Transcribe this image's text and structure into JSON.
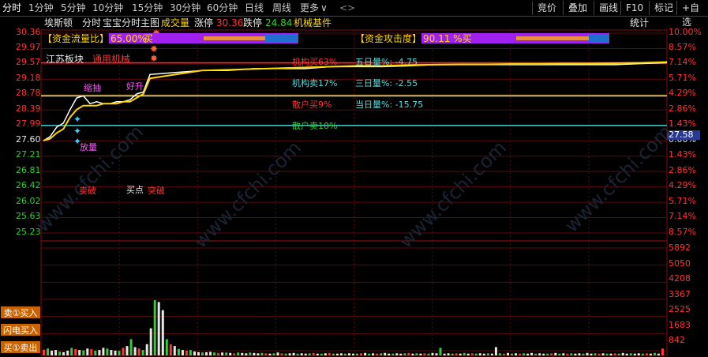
{
  "tabs": [
    {
      "label": "分时",
      "active": true
    },
    {
      "label": "1分钟"
    },
    {
      "label": "5分钟"
    },
    {
      "label": "10分钟"
    },
    {
      "label": "15分钟"
    },
    {
      "label": "30分钟"
    },
    {
      "label": "60分钟"
    },
    {
      "label": "日线"
    },
    {
      "label": "周线"
    },
    {
      "label": "更多"
    }
  ],
  "right_buttons": [
    "竞价",
    "叠加",
    "画线",
    "F10",
    "标记",
    "+自选"
  ],
  "header": {
    "stock_name": "埃斯顿",
    "mode": "分时",
    "indicator": "宝宝分时主图",
    "volume_label": "成交量",
    "limit_up_label": "涨停",
    "limit_up_value": "30.36",
    "limit_down_label": "跌停",
    "limit_down_value": "24.84",
    "sector": "机械基件",
    "stats_label": "统计"
  },
  "price_axis": [
    "30.36",
    "29.97",
    "29.57",
    "29.18",
    "28.78",
    "28.39",
    "27.99",
    "27.60",
    "27.21",
    "26.81",
    "26.42",
    "26.02",
    "25.63",
    "25.23"
  ],
  "percent_axis": [
    "10.00%",
    "8.57%",
    "7.14%",
    "5.71%",
    "4.29%",
    "2.86%",
    "1.43%",
    "0.00%",
    "1.43%",
    "2.86%",
    "4.29%",
    "5.71%",
    "7.14%",
    "8.57%"
  ],
  "current_price": "27.58",
  "volume_axis": [
    "5892",
    "5050",
    "4208",
    "3367",
    "2525",
    "1683",
    "842"
  ],
  "capital_flow": {
    "label": "【资金流量比】",
    "value": "65.00%",
    "suffix": "买"
  },
  "attack": {
    "label": "【资金攻击度】",
    "value": "90.11 %买"
  },
  "sector_labels": {
    "province": "江苏板块",
    "industry": "通用机械"
  },
  "stats": {
    "inst_buy": "机构买63%",
    "inst_sell": "机构卖17%",
    "retail_buy": "散户买9%",
    "retail_sell": "散户卖10%",
    "d5": "五日量%: -4.75",
    "d3": "三日量%: -2.55",
    "d1": "当日量%: -15.75"
  },
  "chart_annotations": {
    "sell_break": "卖破",
    "buy_point": "买点",
    "break_up": "突破",
    "fang_liang": "放量",
    "suo_chou": "缩抽",
    "hao_sheng": "好升"
  },
  "left_buttons": [
    "卖①买入",
    "闪电买入",
    "买①卖出"
  ],
  "watermark": "www.cfchi.com",
  "colors": {
    "up": "#ff3333",
    "down": "#33cc33",
    "price_line": "#ffffff",
    "avg_line": "#ffd700",
    "panel_bg": "#000000"
  },
  "chart_data": [
    {
      "type": "line",
      "title": "",
      "xlabel": "",
      "ylabel": "",
      "ylim": [
        25.23,
        30.36
      ],
      "series": [
        {
          "values": [
            27.6,
            27.7,
            27.95,
            28.05,
            28.4,
            28.7,
            28.75,
            28.55,
            28.6,
            28.55,
            28.55,
            28.6,
            28.6,
            28.65,
            28.8,
            28.85,
            29.3,
            29.35,
            29.4,
            29.4,
            29.45,
            29.45,
            29.45,
            29.5,
            29.5,
            29.5,
            29.52,
            29.55,
            29.55,
            29.55,
            29.55,
            29.55,
            29.55,
            29.55,
            29.55,
            29.58,
            29.6
          ]
        },
        {
          "values": [
            27.6,
            27.65,
            27.8,
            27.9,
            28.2,
            28.4,
            28.5,
            28.5,
            28.5,
            28.55,
            28.55,
            28.55,
            28.6,
            28.6,
            28.7,
            28.8,
            29.2,
            29.3,
            29.4,
            29.42,
            29.44,
            29.46,
            29.48,
            29.5,
            29.52,
            29.52,
            29.54,
            29.55,
            29.56,
            29.56,
            29.57,
            29.57,
            29.58,
            29.58,
            29.59,
            29.6,
            29.62
          ]
        }
      ]
    },
    {
      "type": "bar",
      "title": "",
      "ylabel": "",
      "ylim": [
        0,
        5892
      ],
      "values": [
        320,
        380,
        260,
        300,
        210,
        180,
        260,
        420,
        350,
        300,
        280,
        380,
        340,
        260,
        300,
        420,
        380,
        300,
        260,
        250,
        420,
        520,
        900,
        460,
        380,
        300,
        620,
        1500,
        3050,
        2950,
        2500,
        900,
        620,
        520,
        360,
        300,
        260,
        300,
        220,
        180,
        160,
        180,
        200,
        160,
        140,
        160,
        160,
        140,
        120,
        160,
        140,
        120,
        160,
        140,
        120,
        140,
        120,
        100,
        120,
        160,
        120,
        100,
        120,
        140,
        100,
        120,
        100,
        120,
        140,
        100,
        100,
        120,
        140,
        100,
        100,
        120,
        100,
        120,
        100,
        100,
        120,
        140,
        100,
        120,
        100,
        120,
        140,
        100,
        100,
        120,
        100,
        120,
        140,
        100,
        120,
        100,
        120,
        100,
        140,
        120,
        420,
        100,
        120,
        100,
        120,
        100,
        140,
        100,
        120,
        100,
        120,
        100,
        120,
        100,
        460,
        120,
        100,
        140,
        100,
        120,
        100,
        120,
        100,
        140,
        100,
        120,
        100,
        100,
        120,
        140,
        100,
        120,
        100,
        120,
        100,
        120,
        100,
        140,
        100,
        120,
        100,
        120,
        100,
        100,
        120,
        100,
        140,
        100,
        120,
        100,
        120,
        100,
        120,
        100,
        140,
        100,
        380
      ]
    }
  ]
}
